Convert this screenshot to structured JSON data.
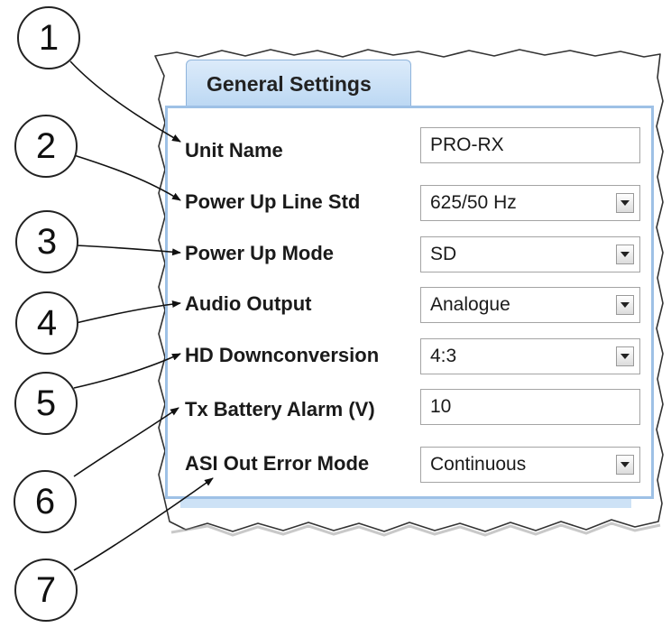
{
  "tab": {
    "label": "General Settings"
  },
  "rows": [
    {
      "label": "Unit Name",
      "value": "PRO-RX",
      "kind": "text"
    },
    {
      "label": "Power Up Line Std",
      "value": "625/50 Hz",
      "kind": "select"
    },
    {
      "label": "Power Up Mode",
      "value": "SD",
      "kind": "select"
    },
    {
      "label": "Audio Output",
      "value": "Analogue",
      "kind": "select"
    },
    {
      "label": "HD Downconversion",
      "value": "4:3",
      "kind": "select"
    },
    {
      "label": "Tx Battery Alarm (V)",
      "value": "10",
      "kind": "text"
    },
    {
      "label": "ASI Out Error Mode",
      "value": "Continuous",
      "kind": "select"
    }
  ],
  "callouts": [
    "1",
    "2",
    "3",
    "4",
    "5",
    "6",
    "7"
  ],
  "colors": {
    "tab_top": "#dcebfa",
    "tab_bottom": "#bcd8f3",
    "panel_border": "#9ec1e6",
    "field_border": "#a4a4a4"
  },
  "icons": {
    "dropdown": "chevron-down-icon"
  }
}
